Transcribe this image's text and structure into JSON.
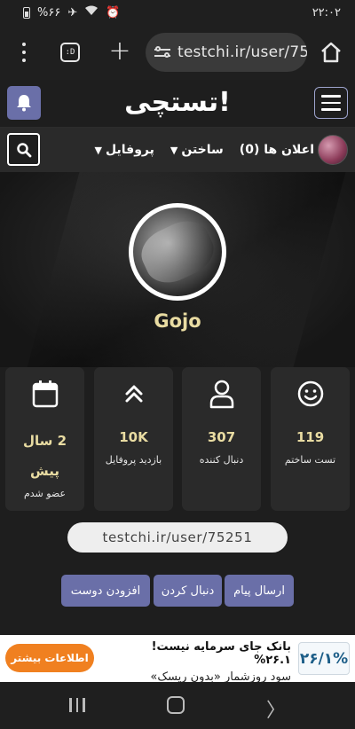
{
  "status_bar": {
    "battery_percent": "%۶۶",
    "time": "۲۲:۰۲"
  },
  "browser": {
    "url": "testchi.ir/user/75"
  },
  "site": {
    "logo_text": "تستچی!",
    "nav": {
      "profile": "پروفایل",
      "build": "ساختن",
      "notifications": "اعلان ها (0)"
    }
  },
  "profile": {
    "username": "Gojo",
    "stats": [
      {
        "value": "119",
        "label": "تست ساختم",
        "icon": "smile-icon"
      },
      {
        "value": "307",
        "label": "دنبال کننده",
        "icon": "user-icon"
      },
      {
        "value": "10K",
        "label": "بازدید پروفایل",
        "icon": "double-chevron-up-icon"
      },
      {
        "value": "2 سال پیش",
        "label": "عضو شدم",
        "icon": "calendar-icon"
      }
    ],
    "profile_url": "testchi.ir/user/75251",
    "actions": {
      "send_message": "ارسال پیام",
      "follow": "دنبال کردن",
      "add_friend": "افزودن دوست"
    }
  },
  "ad": {
    "logo_text": "۲۶/۱%",
    "line1": "بانک جای سرمایه نیست! ۲۶.۱%",
    "line2": "سود روزشمار «بدون ریسک»",
    "button": "اطلاعات بیشتر"
  },
  "colors": {
    "accent": "#6a6fa8",
    "gold_text": "#e9dca2",
    "background": "#1e1e1e",
    "card": "#2a2a2a",
    "ad_button": "#f08020"
  }
}
